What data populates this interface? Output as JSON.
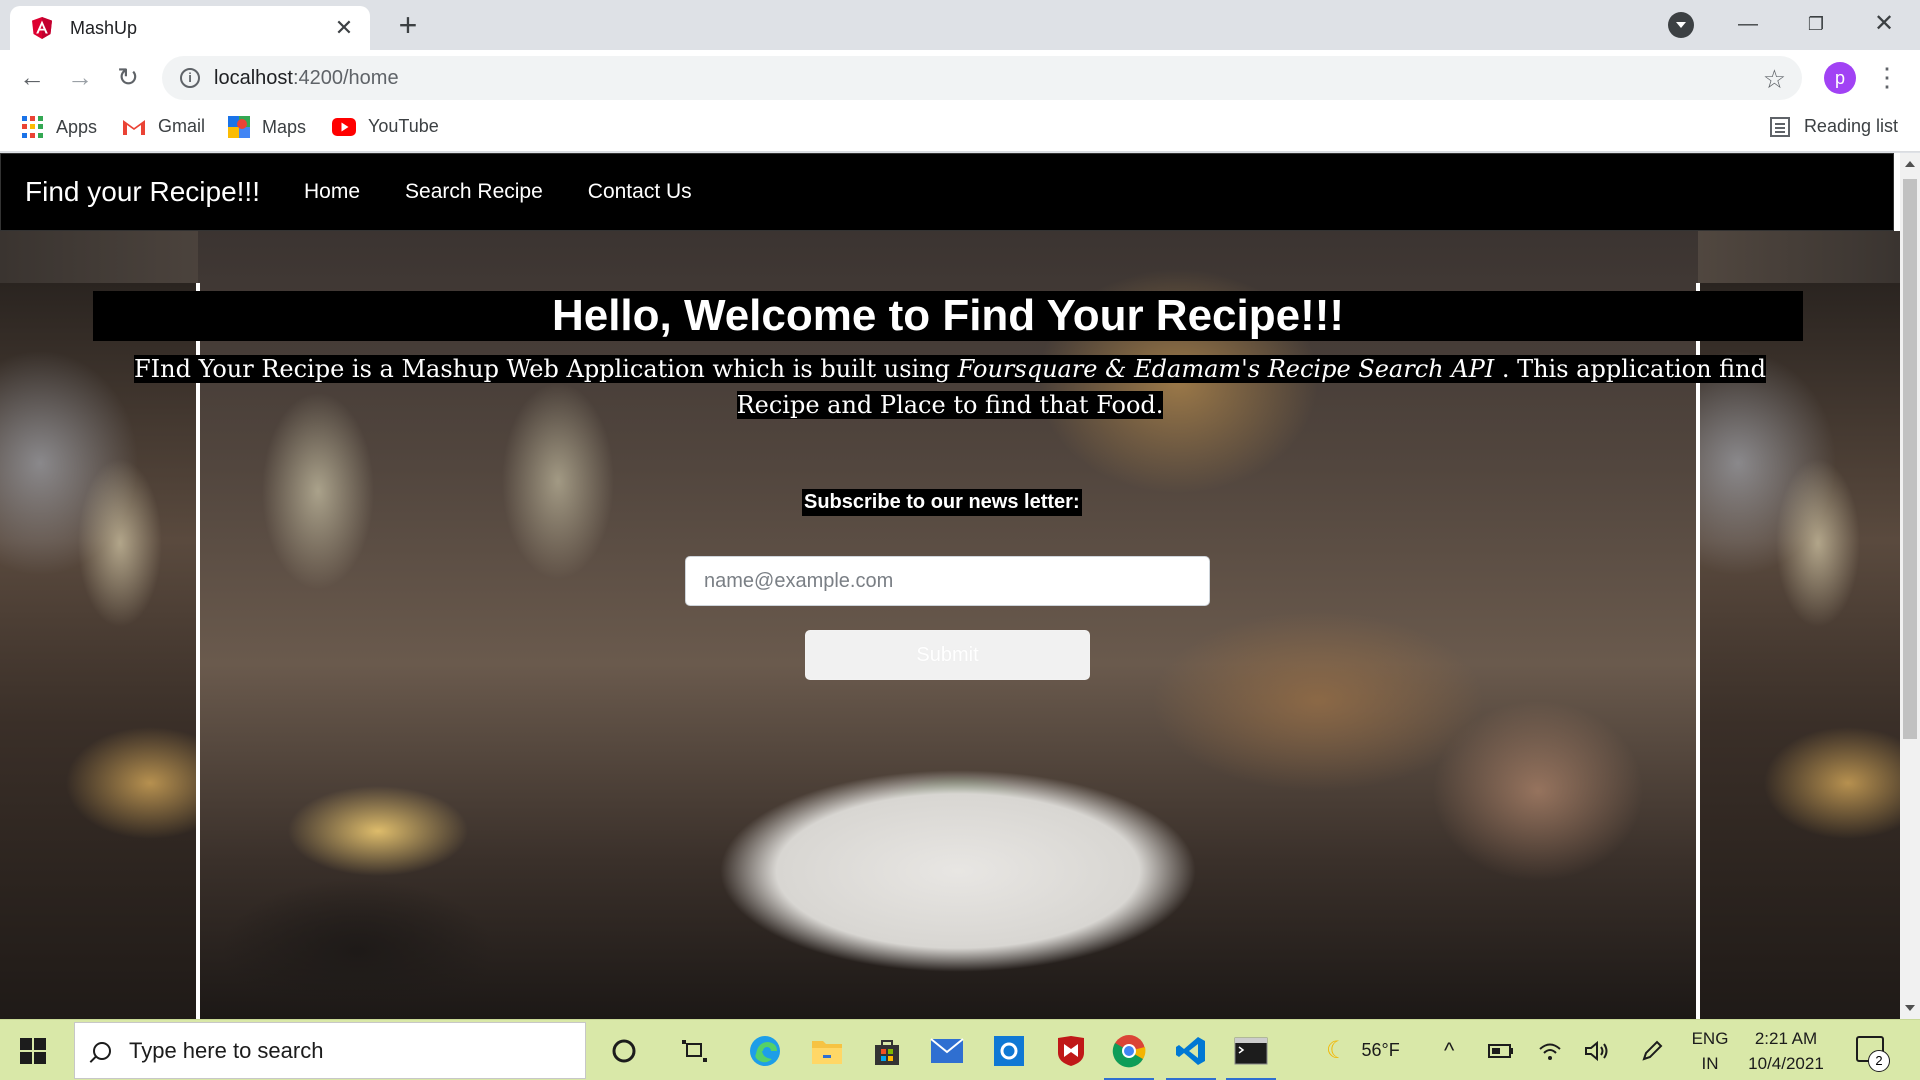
{
  "browser": {
    "tab_title": "MashUp",
    "url_host": "localhost",
    "url_path": ":4200/home",
    "profile_initial": "p",
    "bookmarks": [
      {
        "label": "Apps",
        "icon": "apps-grid-icon"
      },
      {
        "label": "Gmail",
        "icon": "gmail-icon"
      },
      {
        "label": "Maps",
        "icon": "maps-icon"
      },
      {
        "label": "YouTube",
        "icon": "youtube-icon"
      }
    ],
    "reading_list": "Reading list"
  },
  "site": {
    "brand": "Find your Recipe!!!",
    "nav": [
      "Home",
      "Search Recipe",
      "Contact Us"
    ],
    "hero": {
      "title_plain": "Hello, Welcome to ",
      "title_bold": "Find Your Recipe!!!",
      "desc_part1": "FInd Your Recipe is a Mashup Web Application which is built using ",
      "desc_italic": "Foursquare & Edamam's Recipe Search API",
      "desc_part2": " . This application find Recipe and Place to find that Food."
    },
    "subscribe": {
      "label": "Subscribe to our news letter:",
      "placeholder": "name@example.com",
      "button": "Submit"
    }
  },
  "taskbar": {
    "search_placeholder": "Type here to search",
    "weather": "56°F",
    "lang_line1": "ENG",
    "lang_line2": "IN",
    "time": "2:21 AM",
    "date": "10/4/2021",
    "notifications": "2"
  },
  "colors": {
    "navbar_bg": "#000000",
    "taskbar_bg": "#d9e8a8",
    "profile": "#a142f4",
    "angular_red": "#dd0031"
  }
}
